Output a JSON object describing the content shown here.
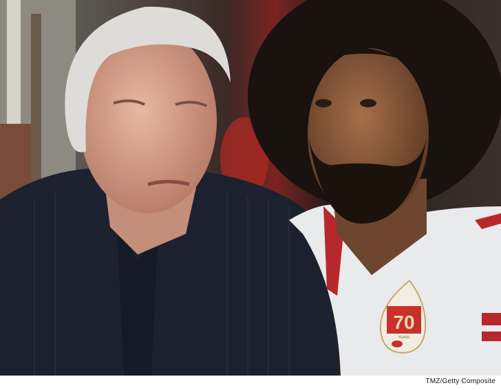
{
  "caption": "TMZ/Getty Composite",
  "patch": {
    "number": "70",
    "subtext": "YEARS"
  },
  "colors": {
    "jacket": "#1c2130",
    "jersey": "#e9eaec",
    "accent_red": "#b7282c",
    "skin_left": "#d9a590",
    "skin_right": "#8a5a3c",
    "hair_left": "#d8d6d2",
    "hair_right": "#1a120e"
  }
}
